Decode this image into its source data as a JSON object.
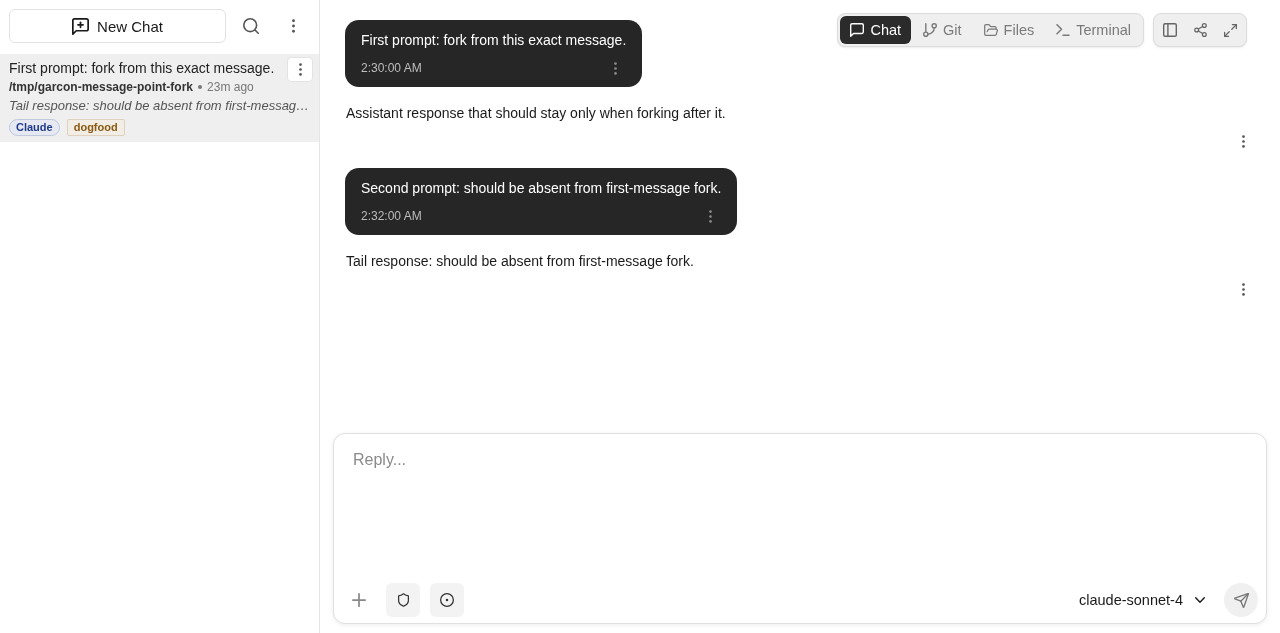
{
  "sidebar": {
    "new_chat": "New Chat",
    "sessions": [
      {
        "title": "First prompt: fork from this exact message.",
        "path": "/tmp/garcon-message-point-fork",
        "age": "23m ago",
        "preview": "Tail response: should be absent from first-messag…",
        "selected": true,
        "tags": [
          {
            "label": "Claude",
            "kind": "agent",
            "color": "#1e3a8a"
          },
          {
            "label": "dogfood",
            "kind": "label",
            "color": "#8a5a12"
          }
        ]
      }
    ]
  },
  "view_tabs": [
    {
      "label": "Chat",
      "selected": true
    },
    {
      "label": "Git",
      "selected": false
    },
    {
      "label": "Files",
      "selected": false
    },
    {
      "label": "Terminal",
      "selected": false
    }
  ],
  "messages": [
    {
      "kind": "user",
      "text": "First prompt: fork from this exact message.",
      "time": "2:30:00 AM"
    },
    {
      "kind": "assistant",
      "text": "Assistant response that should stay only when forking after it."
    },
    {
      "kind": "user",
      "text": "Second prompt: should be absent from first-message fork.",
      "time": "2:32:00 AM"
    },
    {
      "kind": "assistant",
      "text": "Tail response: should be absent from first-message fork."
    }
  ],
  "composer": {
    "placeholder": "Reply...",
    "model": "claude-sonnet-4"
  }
}
